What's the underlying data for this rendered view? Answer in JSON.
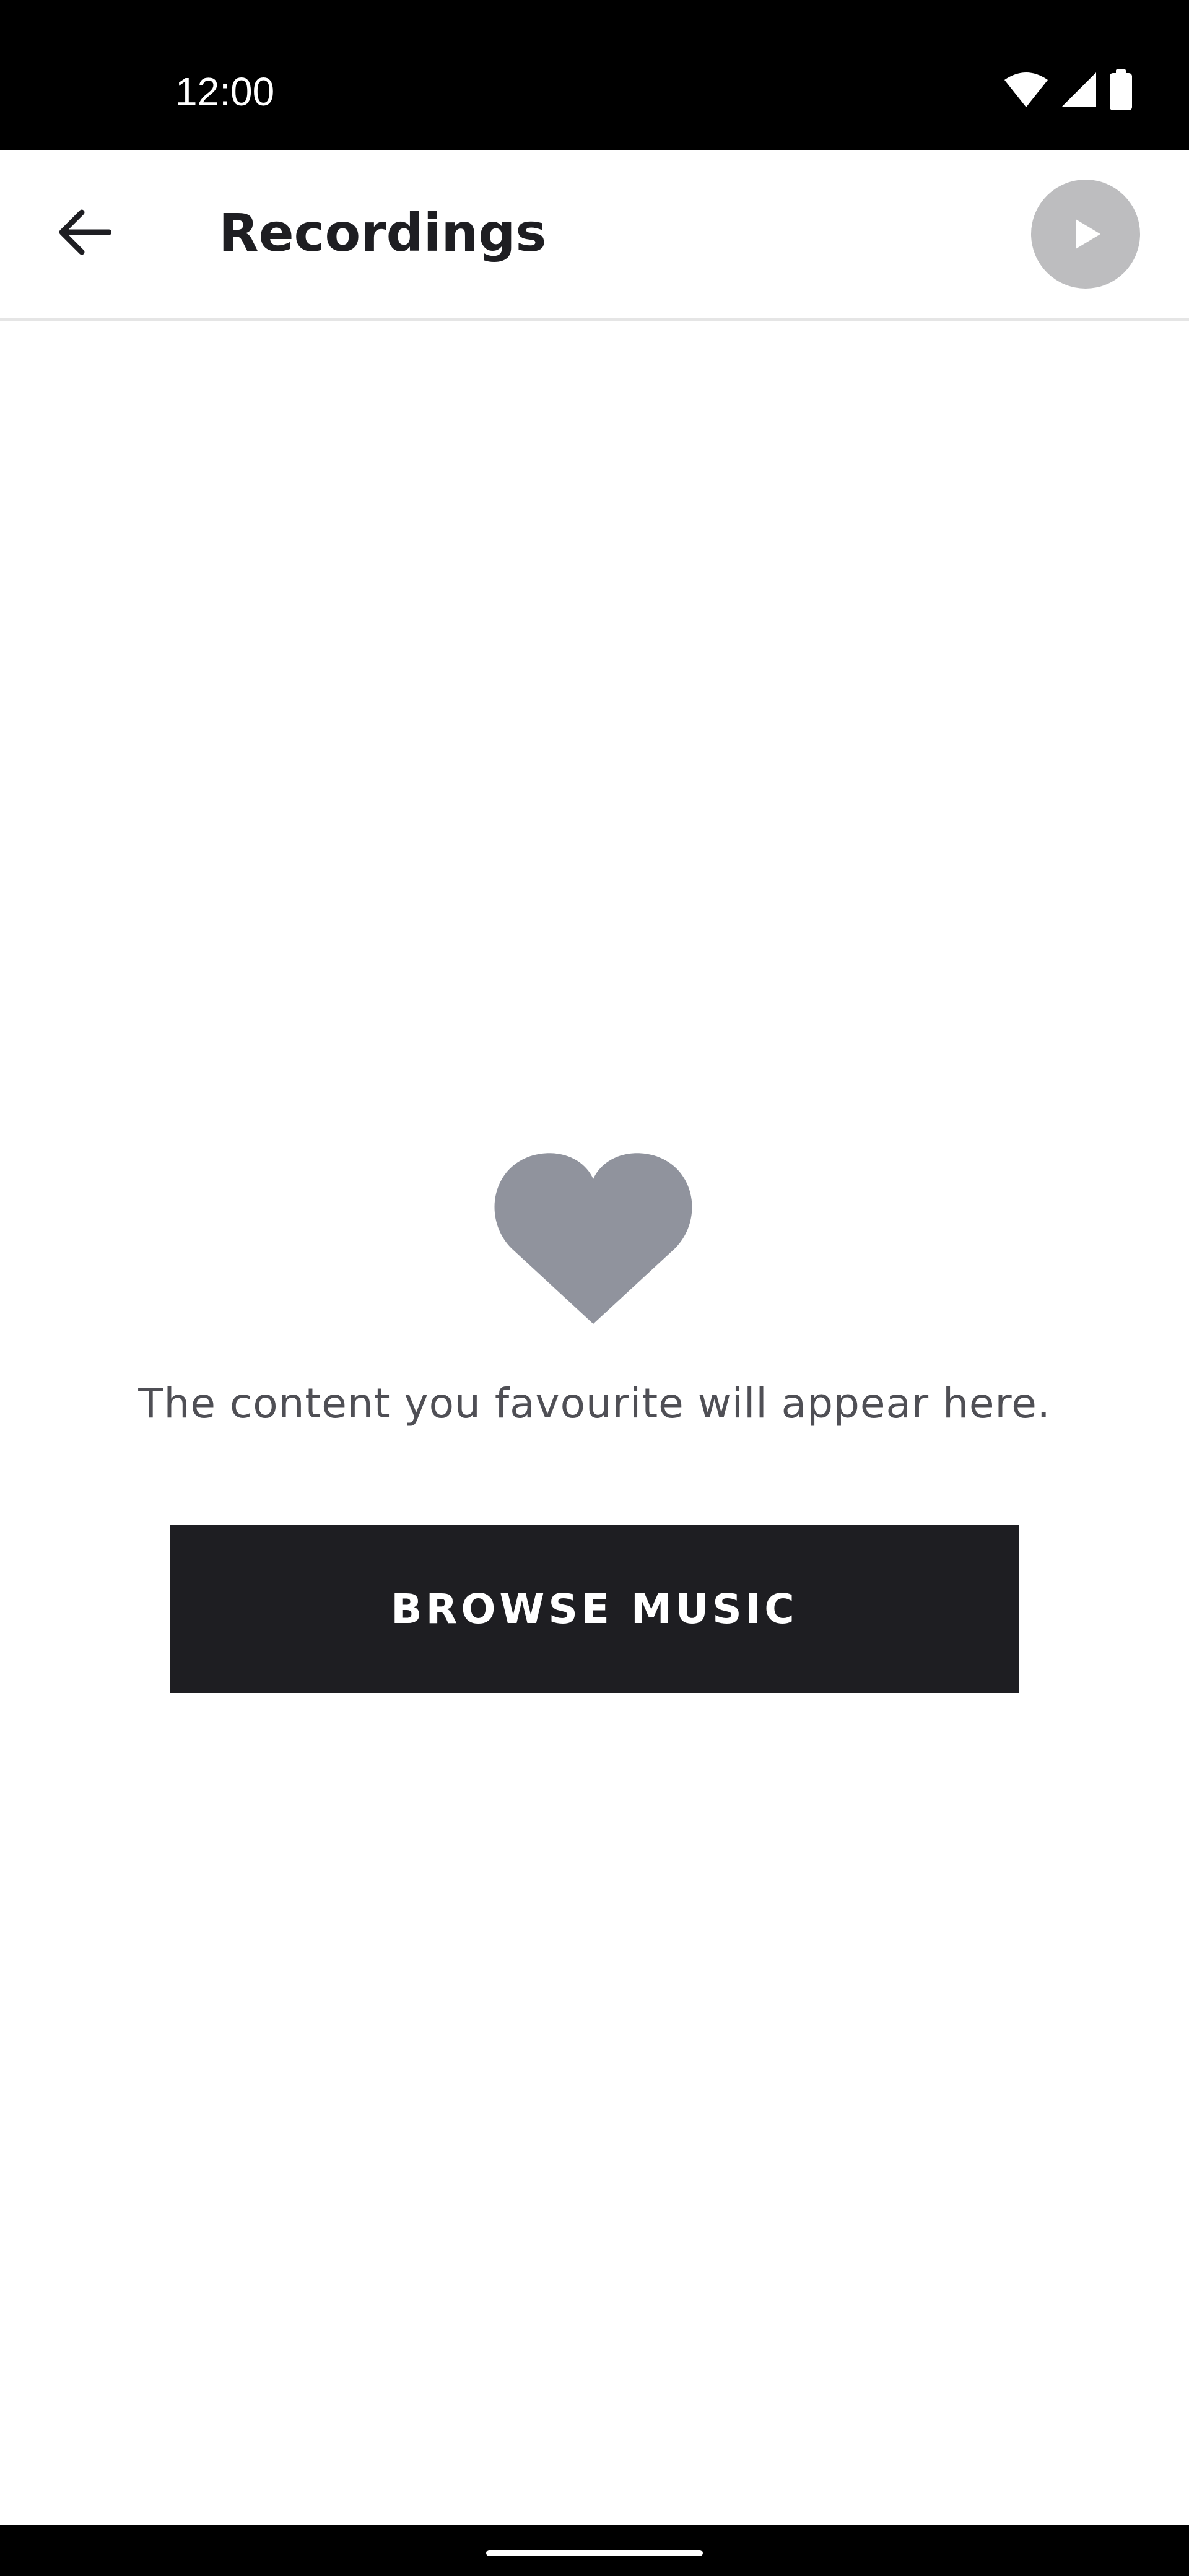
{
  "status_bar": {
    "time": "12:00",
    "icons": [
      "wifi-icon",
      "cellular-signal-icon",
      "battery-icon"
    ]
  },
  "app_bar": {
    "back_icon": "arrow-left-icon",
    "title": "Recordings",
    "play_icon": "play-icon"
  },
  "empty_state": {
    "icon": "heart-icon",
    "message": "The content you favourite will appear here.",
    "button_label": "BROWSE MUSIC"
  },
  "colors": {
    "status_bar_bg": "#000000",
    "title_text": "#1e1e22",
    "play_button_bg": "#bdbdbf",
    "heart_icon": "#90939d",
    "message_text": "#4f4f55",
    "button_bg": "#1e1e22",
    "button_text": "#ffffff"
  }
}
